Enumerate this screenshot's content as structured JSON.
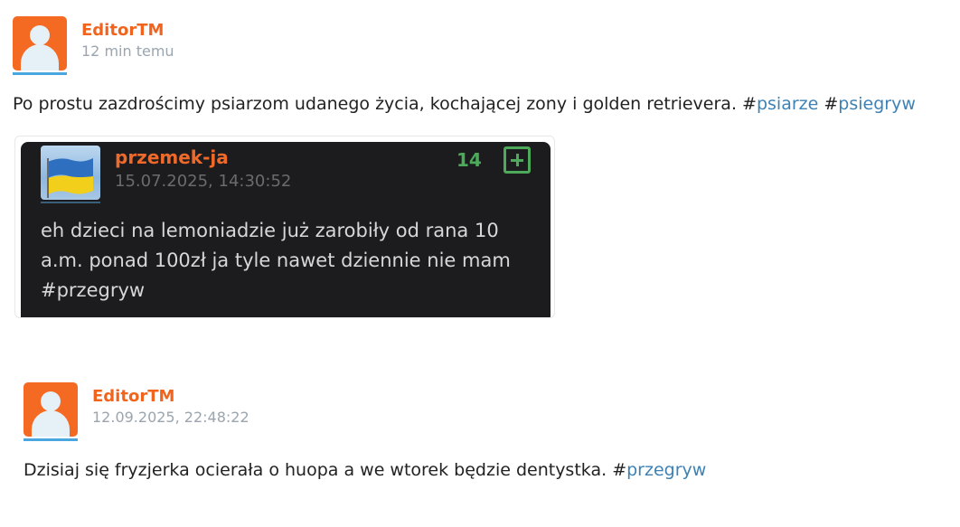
{
  "post1": {
    "author": "EditorTM",
    "time": "12 min temu",
    "text_plain": "Po prostu zazdrościmy psiarzom udanego życia, kochającej zony i golden retrievera. ",
    "tags": [
      "psiarze",
      "psiegryw"
    ],
    "hash": "#",
    "embed": {
      "author": "przemek-ja",
      "time": "15.07.2025, 14:30:52",
      "score": "14",
      "text": "eh dzieci na lemoniadzie już zarobiły od rana 10 a.m. ponad 100zł ja tyle nawet dziennie nie mam #przegryw",
      "avatar_icon": "ukraine-flag-avatar"
    }
  },
  "post2": {
    "author": "EditorTM",
    "time": "12.09.2025, 22:48:22",
    "text_plain": "Dzisiaj się fryzjerka ocierała o huopa a we wtorek będzie dentystka. ",
    "tags": [
      "przegryw"
    ],
    "hash": "#"
  },
  "colors": {
    "author": "#f0641e",
    "tag": "#3d81b5",
    "avatar_bg": "#f56a22",
    "embed_bg": "#1c1c1e",
    "plus_green": "#4caa5a"
  }
}
